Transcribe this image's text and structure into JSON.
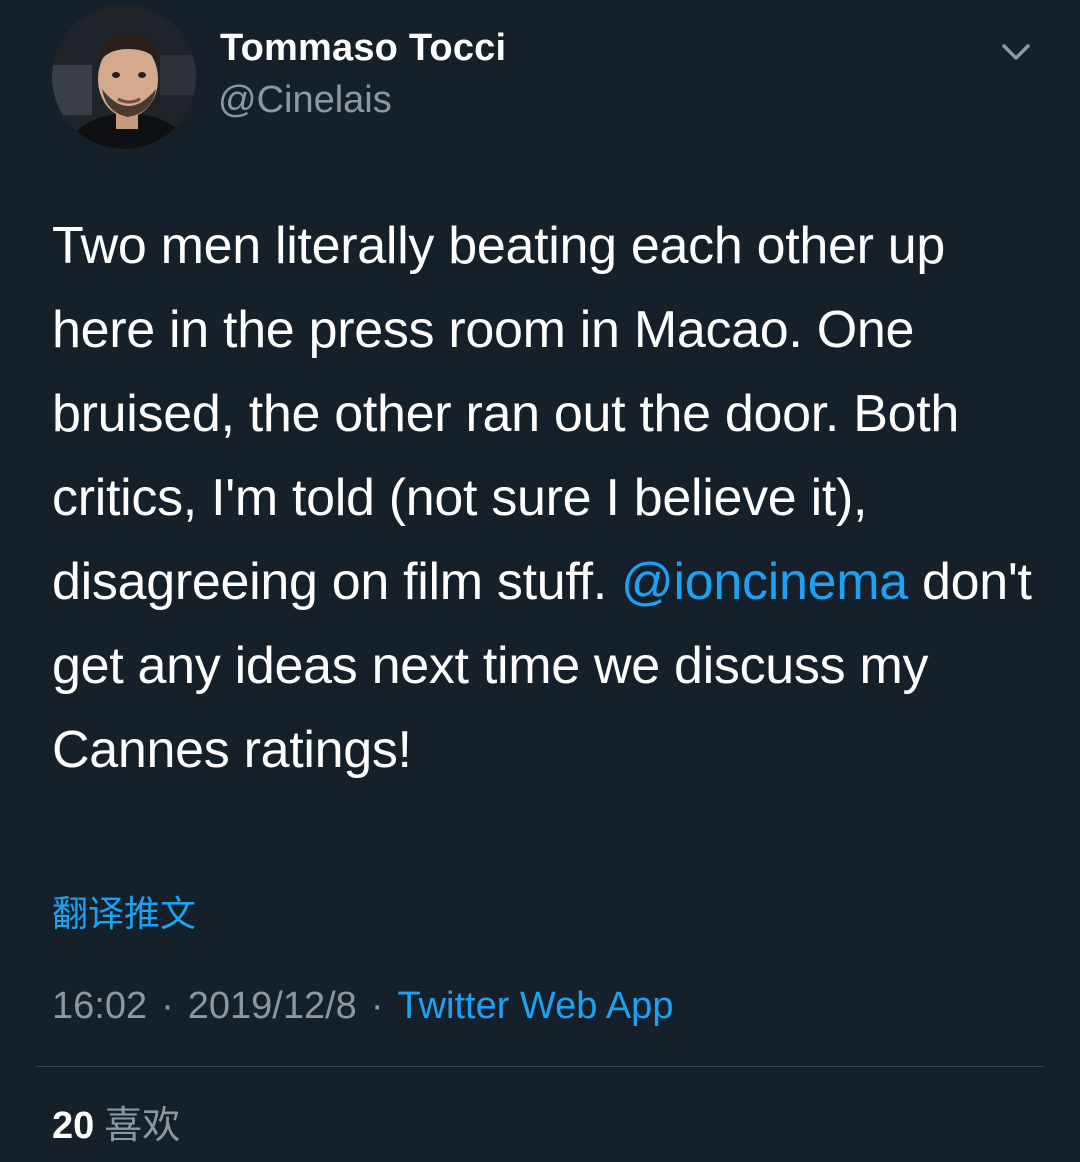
{
  "author": {
    "name": "Tommaso Tocci",
    "handle": "@Cinelais",
    "avatar_icon": "profile-photo"
  },
  "menu": {
    "icon": "chevron-down-icon"
  },
  "tweet": {
    "text_before": "Two men literally beating each other up here in the press room in Macao. One bruised, the other ran out the door. Both critics, I'm told (not sure I believe it), disagreeing on film stuff.",
    "mention": "@ioncinema",
    "text_after": "don't get any ideas next time we discuss my Cannes ratings!"
  },
  "translate_label": "翻译推文",
  "meta": {
    "time": "16:02",
    "separator": "·",
    "date": "2019/12/8",
    "source": "Twitter Web App"
  },
  "stats": {
    "likes_count": "20",
    "likes_label": "喜欢"
  },
  "colors": {
    "background": "#15202b",
    "text": "#ffffff",
    "secondary": "#8899a6",
    "link": "#1da1f2",
    "divider": "#38444d"
  }
}
